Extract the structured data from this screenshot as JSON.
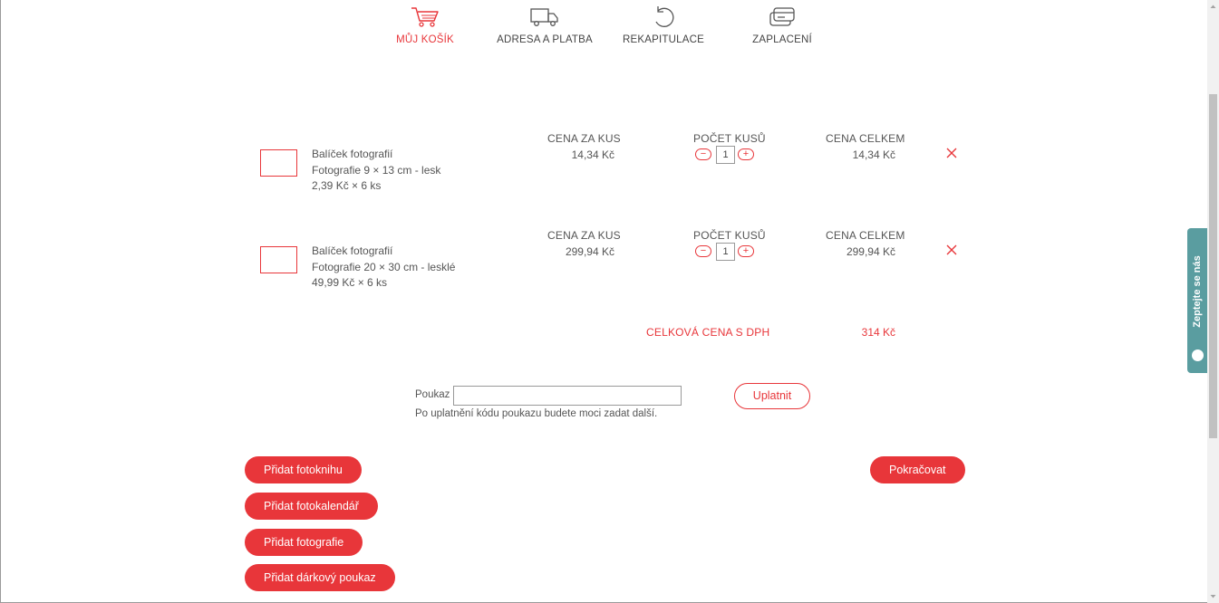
{
  "steps": [
    {
      "label": "MŮJ KOŠÍK",
      "icon": "cart-icon",
      "active": true
    },
    {
      "label": "ADRESA A PLATBA",
      "icon": "truck-icon",
      "active": false
    },
    {
      "label": "REKAPITULACE",
      "icon": "refresh-icon",
      "active": false
    },
    {
      "label": "ZAPLACENÍ",
      "icon": "payment-card-icon",
      "active": false
    }
  ],
  "cart": {
    "columns": {
      "unit_price": "CENA ZA KUS",
      "quantity": "POČET KUSŮ",
      "total": "CENA CELKEM"
    },
    "items": [
      {
        "name": "Balíček fotografií",
        "variant": "Fotografie 9 × 13 cm - lesk",
        "unit_detail": "2,39 Kč × 6 ks",
        "unit_price": "14,34 Kč",
        "quantity": "1",
        "total": "14,34 Kč"
      },
      {
        "name": "Balíček fotografií",
        "variant": "Fotografie 20 × 30 cm - lesklé",
        "unit_detail": "49,99 Kč × 6 ks",
        "unit_price": "299,94 Kč",
        "quantity": "1",
        "total": "299,94 Kč"
      }
    ],
    "grand_total_label": "CELKOVÁ CENA S DPH",
    "grand_total_value": "314 Kč",
    "minus_symbol": "−",
    "plus_symbol": "+"
  },
  "voucher": {
    "label": "Poukaz",
    "value": "",
    "hint": "Po uplatnění kódu poukazu budete moci zadat další.",
    "apply_label": "Uplatnit"
  },
  "actions": {
    "add_photobook": "Přidat fotoknihu",
    "add_calendar": "Přidat fotokalendář",
    "add_photos": "Přidat fotografie",
    "add_gift_voucher": "Přidat dárkový poukaz",
    "continue": "Pokračovat"
  },
  "side_tab": {
    "label": "Zeptejte se nás"
  },
  "colors": {
    "accent": "#e8363a",
    "side_tab": "#5a9da0",
    "text": "#555555"
  }
}
